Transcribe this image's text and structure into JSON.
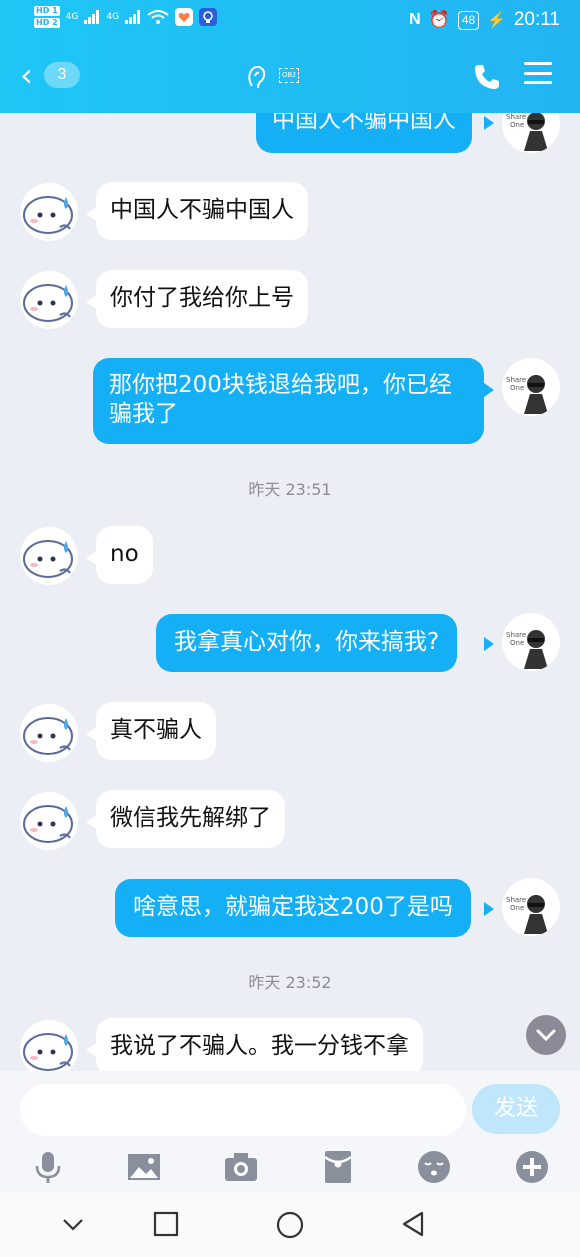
{
  "status_bar": {
    "hd1": "HD 1",
    "hd2": "HD 2",
    "network1": "4G",
    "network2": "4G",
    "battery": "48",
    "time": "20:11"
  },
  "header": {
    "back_glyph": "‹",
    "unread_count": "3",
    "obj_label": "OBJ"
  },
  "messages": [
    {
      "side": "out",
      "text": "中国人不骗中国人"
    },
    {
      "side": "in",
      "text": "中国人不骗中国人"
    },
    {
      "side": "in",
      "text": "你付了我给你上号"
    },
    {
      "side": "out",
      "text": "那你把200块钱退给我吧，你已经骗我了"
    },
    {
      "timestamp": "昨天 23:51"
    },
    {
      "side": "in",
      "text": "no"
    },
    {
      "side": "out",
      "text": "我拿真心对你，你来搞我?"
    },
    {
      "side": "in",
      "text": "真不骗人"
    },
    {
      "side": "in",
      "text": "微信我先解绑了"
    },
    {
      "side": "out",
      "text": "啥意思，就骗定我这200了是吗"
    },
    {
      "timestamp": "昨天 23:52"
    },
    {
      "side": "in",
      "text": "我说了不骗人。我一分钱不拿"
    }
  ],
  "input": {
    "value": "",
    "send_label": "发送"
  },
  "toolbar_icons": [
    "microphone-icon",
    "image-icon",
    "camera-icon",
    "red-packet-icon",
    "emoji-icon",
    "plus-icon"
  ],
  "colors": {
    "header": "#1fc6f6",
    "outgoing_bubble": "#14aff4",
    "incoming_bubble": "#ffffff",
    "background": "#eceef6"
  }
}
